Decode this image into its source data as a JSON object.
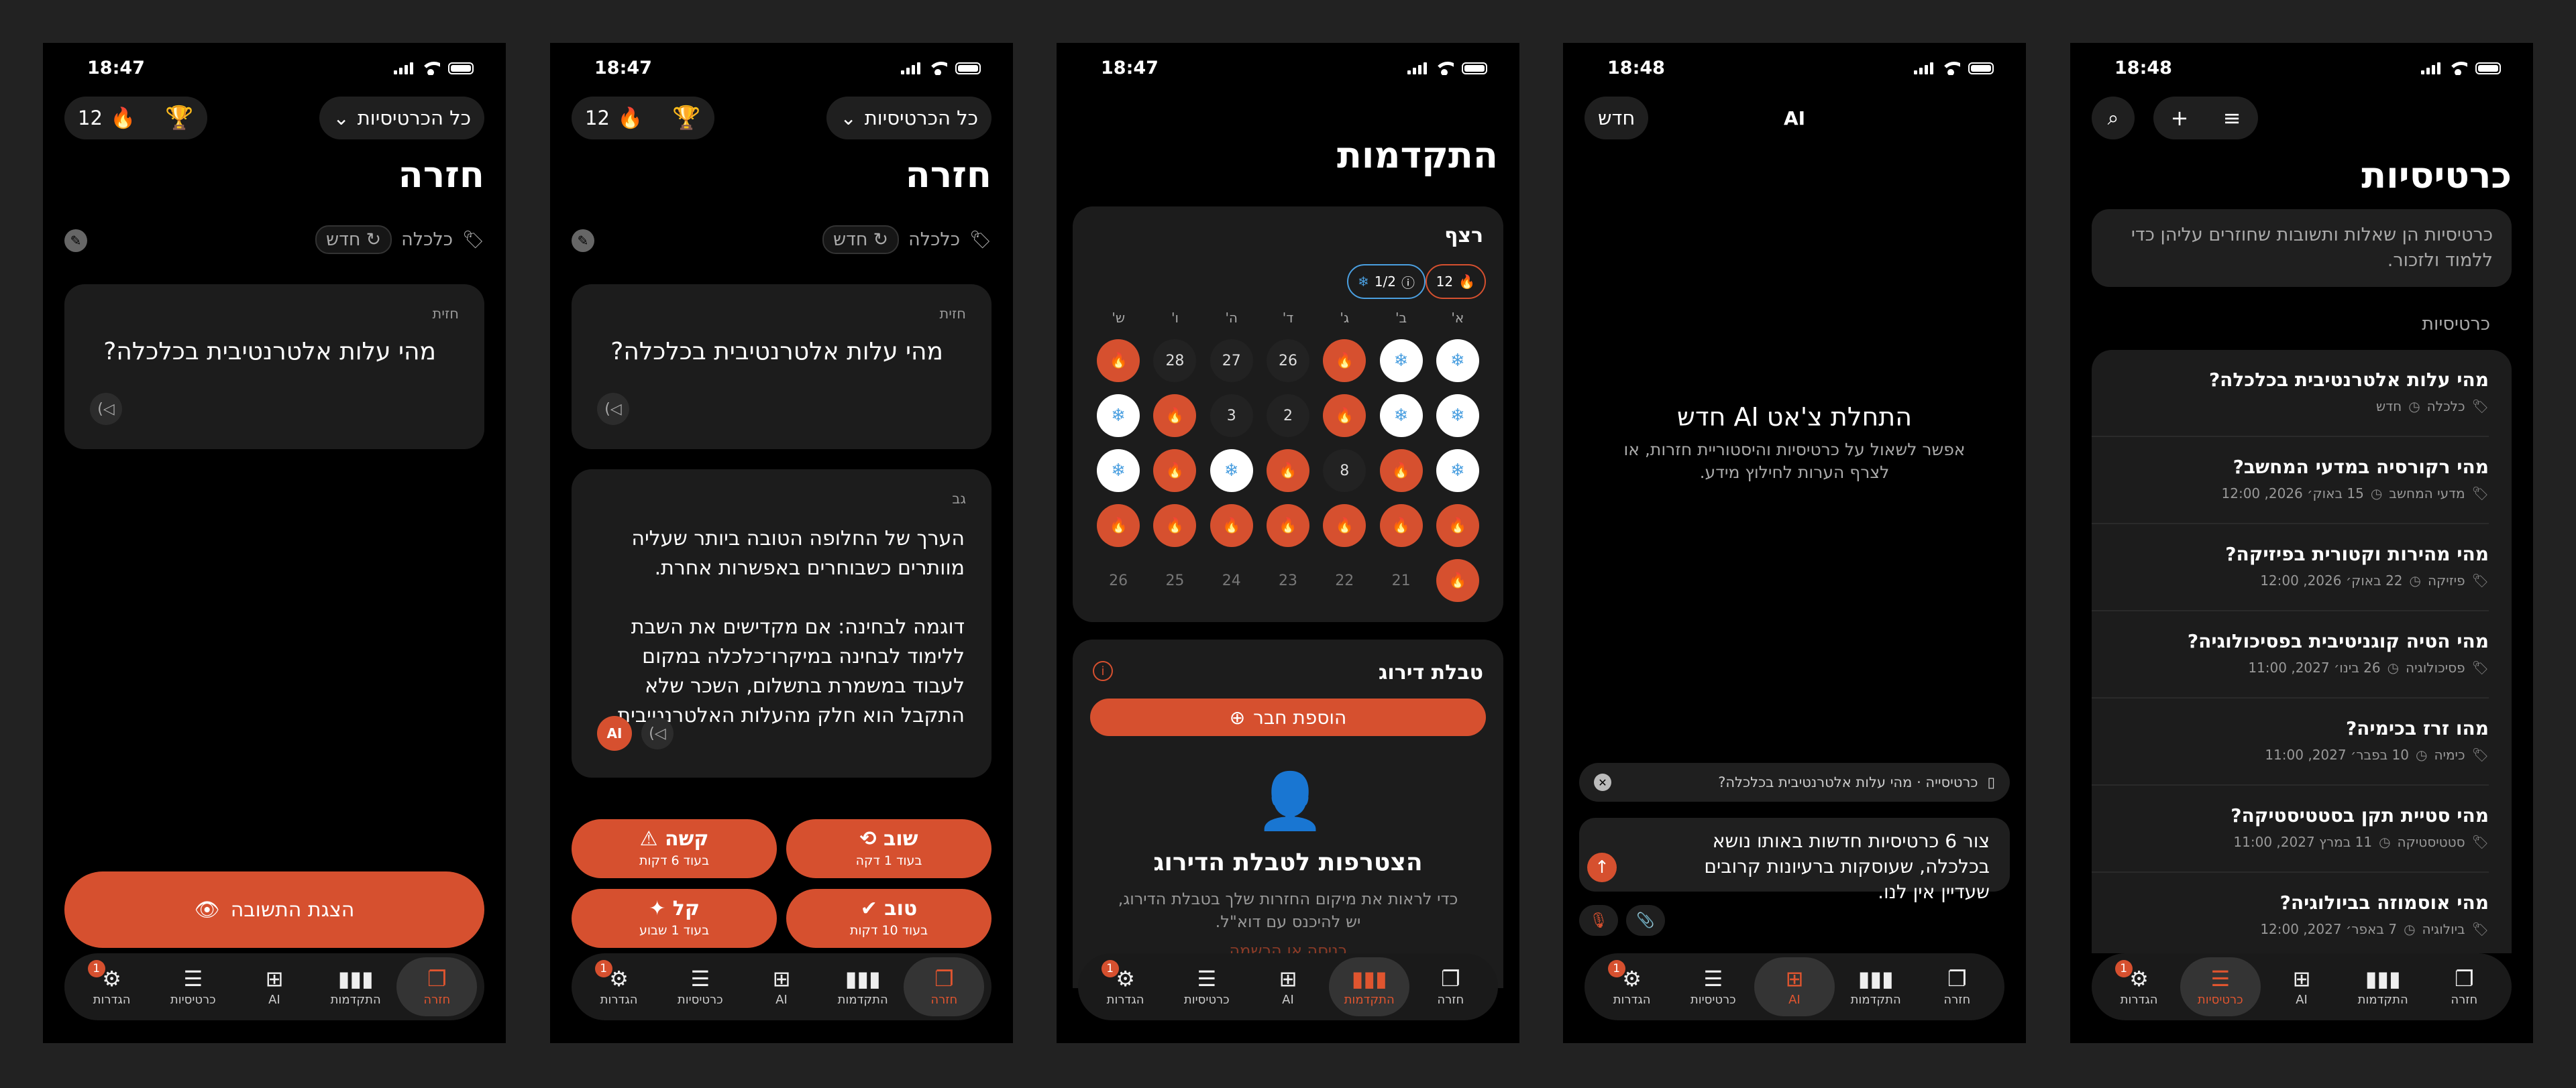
{
  "common": {
    "time1": "18:47",
    "time2": "18:48",
    "streak_count": "12",
    "deck_select": "כל הכרטיסיות",
    "review_title": "חזרה",
    "tag_label": "כלכלה",
    "new_chip": "חדש",
    "front_label": "חזית",
    "back_label": "גב",
    "question": "מהי עלות אלטרנטיבית בכלכלה?",
    "ai_badge": "AI",
    "notification_count": "1"
  },
  "tabs": [
    "חזרה",
    "התקדמות",
    "AI",
    "כרטיסיות",
    "הגדרות"
  ],
  "tab_icons": [
    "cards-icon",
    "chart-icon",
    "ai-icon",
    "stack-icon",
    "gear-icon"
  ],
  "screen1": {
    "show_answer": "הצגת התשובה"
  },
  "screen2": {
    "answer": "הערך של החלופה הטובה ביותר שעליה מוותרים כשבוחרים באפשרות אחרת.\n\nדוגמה לבחינה: אם מקדישים את השבת ללימוד לבחינה במיקרו־כלכלה במקום לעבוד במשמרת בתשלום, השכר שלא התקבל הוא חלק מהעלות האלטרנטיבית.",
    "grades": [
      {
        "title": "שוב",
        "sub": "בעוד 1 דקה"
      },
      {
        "title": "קשה",
        "sub": "בעוד 6 דקות"
      },
      {
        "title": "טוב",
        "sub": "בעוד 10 דקות"
      },
      {
        "title": "קל",
        "sub": "בעוד 1 שבוע"
      }
    ]
  },
  "screen3": {
    "title": "התקדמות",
    "streak_title": "רצף",
    "freeze": "1/2",
    "streak": "12",
    "day_headers": [
      "א'",
      "ב'",
      "ג'",
      "ד'",
      "ה'",
      "ו'",
      "ש'"
    ],
    "days": [
      {
        "t": "z",
        "v": ""
      },
      {
        "t": "z",
        "v": ""
      },
      {
        "t": "f",
        "v": ""
      },
      {
        "t": "n",
        "v": "26"
      },
      {
        "t": "n",
        "v": "27"
      },
      {
        "t": "n",
        "v": "28"
      },
      {
        "t": "f",
        "v": ""
      },
      {
        "t": "z",
        "v": ""
      },
      {
        "t": "z",
        "v": ""
      },
      {
        "t": "f",
        "v": ""
      },
      {
        "t": "n",
        "v": "2"
      },
      {
        "t": "n",
        "v": "3"
      },
      {
        "t": "f",
        "v": ""
      },
      {
        "t": "z",
        "v": ""
      },
      {
        "t": "z",
        "v": ""
      },
      {
        "t": "f",
        "v": ""
      },
      {
        "t": "n",
        "v": "8"
      },
      {
        "t": "f",
        "v": ""
      },
      {
        "t": "z",
        "v": ""
      },
      {
        "t": "f",
        "v": ""
      },
      {
        "t": "z",
        "v": ""
      },
      {
        "t": "f",
        "v": ""
      },
      {
        "t": "f",
        "v": ""
      },
      {
        "t": "f",
        "v": ""
      },
      {
        "t": "f",
        "v": ""
      },
      {
        "t": "f",
        "v": ""
      },
      {
        "t": "f",
        "v": ""
      },
      {
        "t": "f",
        "v": ""
      },
      {
        "t": "f",
        "v": ""
      },
      {
        "t": "m",
        "v": "21"
      },
      {
        "t": "m",
        "v": "22"
      },
      {
        "t": "m",
        "v": "23"
      },
      {
        "t": "m",
        "v": "24"
      },
      {
        "t": "m",
        "v": "25"
      },
      {
        "t": "m",
        "v": "26"
      }
    ],
    "leaderboard_title": "טבלת דירוג",
    "add_friend": "הוספת חבר",
    "join_title": "הצטרפות לטבלת הדירוג",
    "join_text": "כדי לראות את מיקום החזרות שלך בטבלת הדירוג, יש להיכנס עם דוא\"ל.",
    "join_link": "כניסה או הרשמה"
  },
  "screen4": {
    "new_btn": "חדש",
    "header": "AI",
    "empty_title": "התחלת צ'אט AI חדש",
    "empty_text": "אפשר לשאול על כרטיסיות והיסטוריית חזרות, או לצרף הערות לחילוץ מידע.",
    "context": "כרטיסייה · מהי עלות אלטרנטיבית בכלכלה?",
    "compose": "צור 6 כרטיסיות חדשות באותו נושא בכלכלה, שעוסקות ברעיונות קרובים שעדיין אין לנו."
  },
  "screen5": {
    "title": "כרטיסיות",
    "info": "כרטיסיות הן שאלות ותשובות שחוזרים עליהן כדי ללמוד ולזכור.",
    "section": "כרטיסיות",
    "rows": [
      {
        "q": "מהי עלות אלטרנטיבית בכלכלה?",
        "tag": "כלכלה",
        "date": "חדש"
      },
      {
        "q": "מהי רקורסיה במדעי המחשב?",
        "tag": "מדעי המחשב",
        "date": "15 באוק׳ 2026, 12:00"
      },
      {
        "q": "מהי מהירות וקטורית בפיזיקה?",
        "tag": "פיזיקה",
        "date": "22 באוק׳ 2026, 12:00"
      },
      {
        "q": "מהי הטיה קוגניטיבית בפסיכולוגיה?",
        "tag": "פסיכולוגיה",
        "date": "26 בינו׳ 2027, 11:00"
      },
      {
        "q": "מהו זרז בכימיה?",
        "tag": "כימיה",
        "date": "10 בפבר׳ 2027, 11:00"
      },
      {
        "q": "מהי סטיית תקן בסטטיסטיקה?",
        "tag": "סטטיסטיקה",
        "date": "11 במרץ 2027, 11:00"
      },
      {
        "q": "מהי אוסמוזה בביולוגיה?",
        "tag": "ביולוגיה",
        "date": "7 באפר׳ 2027, 12:00"
      }
    ]
  },
  "colors": {
    "accent": "#d6502f",
    "frozen": "#4a9fe0"
  }
}
